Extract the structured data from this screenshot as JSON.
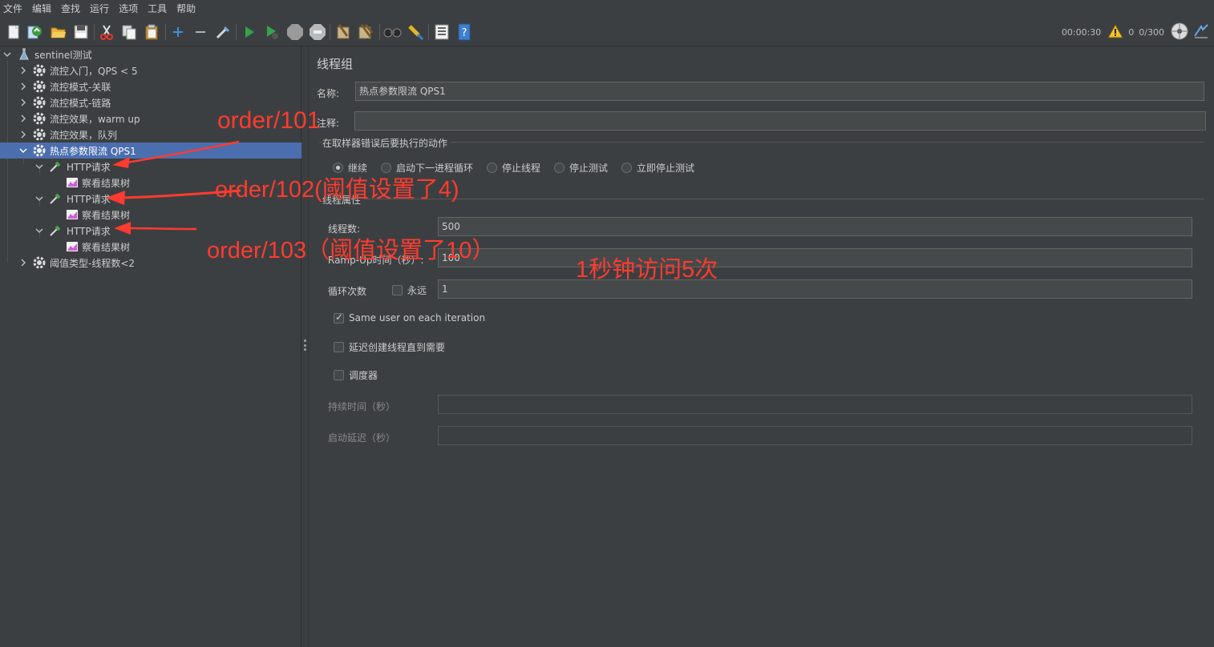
{
  "menu": [
    "文件",
    "编辑",
    "查找",
    "运行",
    "选项",
    "工具",
    "帮助"
  ],
  "toolbar_status": {
    "elapsed": "00:00:30",
    "warnings": "0",
    "threads": "0/300"
  },
  "tree": {
    "root": "sentinel测试",
    "items": [
      {
        "label": "流控入门，QPS < 5"
      },
      {
        "label": "流控模式-关联"
      },
      {
        "label": "流控模式-链路"
      },
      {
        "label": "流控效果，warm up"
      },
      {
        "label": "流控效果，队列"
      },
      {
        "label": "热点参数限流 QPS1"
      },
      {
        "label": "HTTP请求"
      },
      {
        "label": "察看结果树"
      },
      {
        "label": "HTTP请求"
      },
      {
        "label": "察看结果树"
      },
      {
        "label": "HTTP请求"
      },
      {
        "label": "察看结果树"
      },
      {
        "label": "阈值类型-线程数<2"
      }
    ]
  },
  "panel": {
    "title": "线程组",
    "name_label": "名称:",
    "name_value": "热点参数限流 QPS1",
    "comment_label": "注释:",
    "comment_value": "",
    "error_action_legend": "在取样器错误后要执行的动作",
    "error_actions": [
      "继续",
      "启动下一进程循环",
      "停止线程",
      "停止测试",
      "立即停止测试"
    ],
    "error_action_selected": "继续",
    "thread_props_legend": "线程属性",
    "threads_label": "线程数:",
    "threads_value": "500",
    "rampup_label": "Ramp-Up时间（秒）:",
    "rampup_value": "100",
    "loop_label": "循环次数",
    "forever_label": "永远",
    "forever_checked": false,
    "loop_value": "1",
    "same_user_label": "Same user on each iteration",
    "same_user_checked": true,
    "delay_create_label": "延迟创建线程直到需要",
    "delay_create_checked": false,
    "scheduler_label": "调度器",
    "scheduler_checked": false,
    "duration_label": "持续时间（秒）",
    "duration_value": "",
    "startup_delay_label": "启动延迟（秒）",
    "startup_delay_value": ""
  },
  "annotations": {
    "a1": "order/101",
    "a2": "order/102(阈值设置了4)",
    "a3": "order/103（阈值设置了10）",
    "a4": "1秒钟访问5次",
    "color": "#ff3b2f"
  },
  "colors": {
    "selection": "#4b6eaf",
    "background": "#3c3f41",
    "annotation": "#ff3b2f"
  }
}
